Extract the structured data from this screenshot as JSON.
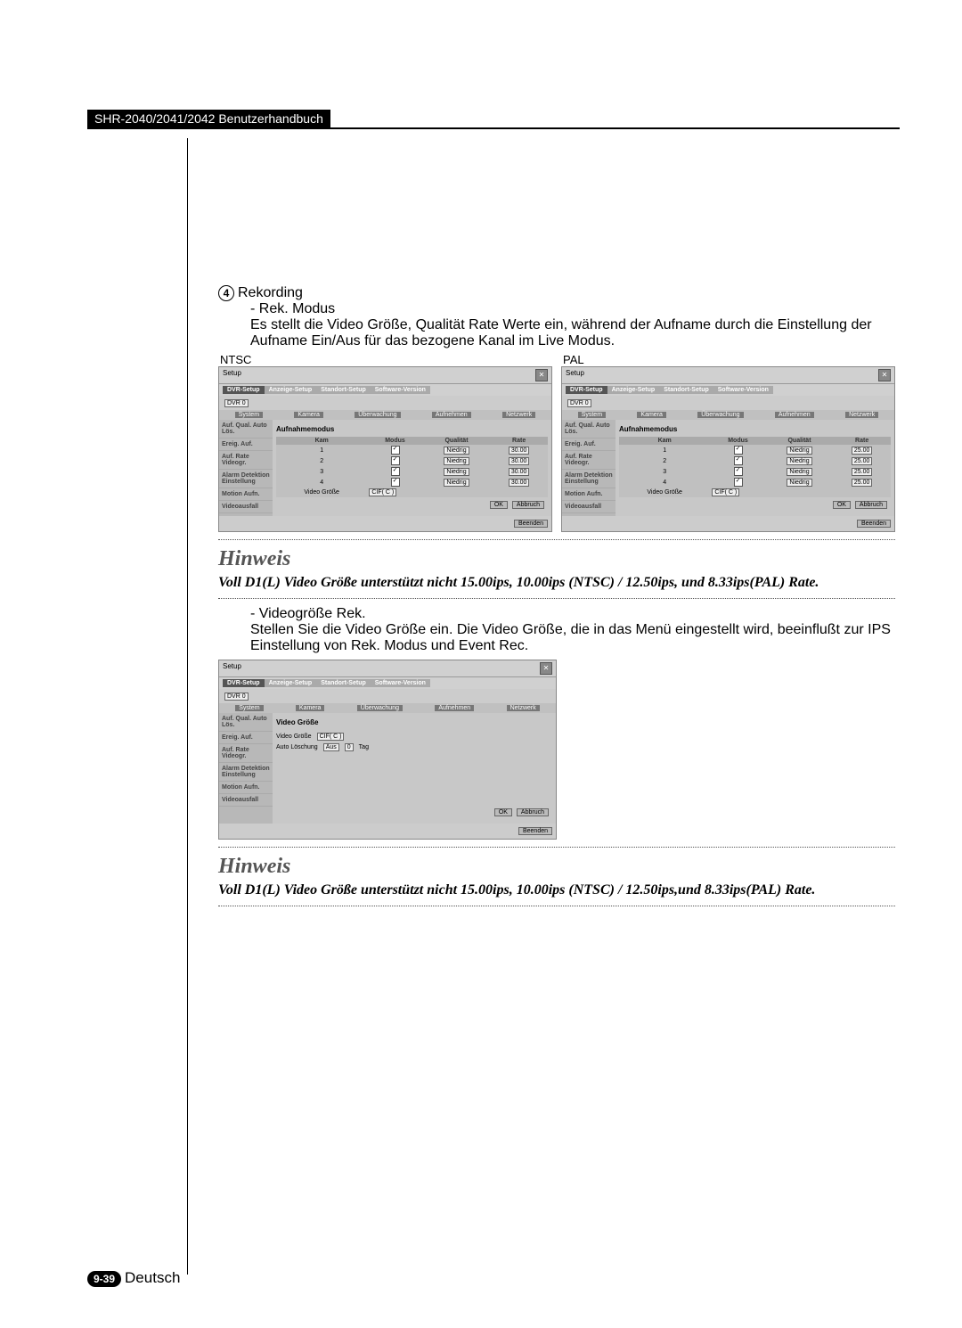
{
  "header": "SHR-2040/2041/2042 Benutzerhandbuch",
  "section_num": "4",
  "section_title": "Rekording",
  "bullet1": "- Rek. Modus",
  "bullet1_desc": "Es stellt die Video Größe, Qualität Rate Werte ein, während der Aufname durch die Einstellung der Aufname Ein/Aus für das bezogene Kanal im Live Modus.",
  "labels": {
    "ntsc": "NTSC",
    "pal": "PAL"
  },
  "scr": {
    "title": "Setup",
    "dvr": "DVR-Setup",
    "tabs": [
      "Anzeige-Setup",
      "Standort-Setup",
      "Software-Version"
    ],
    "dropdown": "DVR 0",
    "toolbar": [
      "System",
      "Kamera",
      "Überwachung",
      "Aufnehmen",
      "Netzwerk"
    ],
    "side": [
      "Auf. Qual. Auto Lös.",
      "Ereig. Auf.",
      "Auf. Rate Videogr.",
      "Alarm Detektion Einstellung",
      "Motion Aufn.",
      "Videoausfall"
    ],
    "panel_title": "Aufnahmemodus",
    "cols": [
      "Kam",
      "Modus",
      "Qualität",
      "Rate"
    ],
    "quality": "Niedrig",
    "rate_ntsc": "30.00",
    "rate_pal": "25.00",
    "video_size_label": "Video Größe",
    "video_size_val": "CIF( C )",
    "ok": "OK",
    "abbr": "Abbruch",
    "beenden": "Beenden"
  },
  "scr2": {
    "panel_title": "Video Größe",
    "row1_label": "Video Größe",
    "row1_val": "CIF( C )",
    "row2_label": "Auto Löschung",
    "row2_val1": "Aus",
    "row2_val2": "0",
    "row2_val3": "Tag"
  },
  "hinweis_label": "Hinweis",
  "note1": "Voll D1(L) Video Größe unterstützt nicht 15.00ips, 10.00ips (NTSC) / 12.50ips, und 8.33ips(PAL) Rate.",
  "bullet2": "- Videogröße Rek.",
  "bullet2_desc": "Stellen Sie die Video Größe ein. Die Video Größe, die in das Menü eingestellt wird, beeinflußt zur IPS Einstellung von Rek. Modus und Event Rec.",
  "note2": "Voll D1(L) Video Größe unterstützt nicht 15.00ips, 10.00ips (NTSC) / 12.50ips,und 8.33ips(PAL) Rate.",
  "footer_badge": "9-39",
  "footer_text": "Deutsch",
  "chart_data": {
    "type": "table",
    "tables": [
      {
        "name": "NTSC Aufnahmemodus",
        "columns": [
          "Kam",
          "Modus",
          "Qualität",
          "Rate"
        ],
        "rows": [
          [
            1,
            "✓",
            "Niedrig",
            "30.00"
          ],
          [
            2,
            "✓",
            "Niedrig",
            "30.00"
          ],
          [
            3,
            "✓",
            "Niedrig",
            "30.00"
          ],
          [
            4,
            "✓",
            "Niedrig",
            "30.00"
          ]
        ],
        "video_size": "CIF( C )"
      },
      {
        "name": "PAL Aufnahmemodus",
        "columns": [
          "Kam",
          "Modus",
          "Qualität",
          "Rate"
        ],
        "rows": [
          [
            1,
            "✓",
            "Niedrig",
            "25.00"
          ],
          [
            2,
            "✓",
            "Niedrig",
            "25.00"
          ],
          [
            3,
            "✓",
            "Niedrig",
            "25.00"
          ],
          [
            4,
            "✓",
            "Niedrig",
            "25.00"
          ]
        ],
        "video_size": "CIF( C )"
      }
    ]
  }
}
